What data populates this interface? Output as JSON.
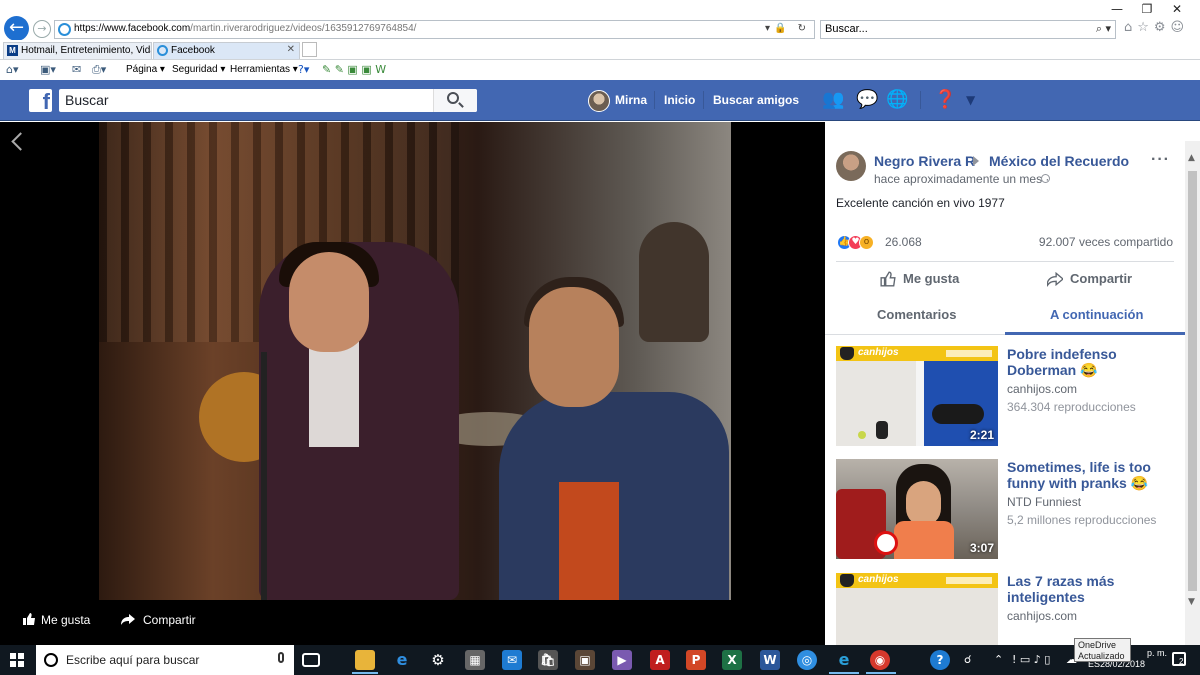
{
  "browser": {
    "url_main": "https://www.facebook.com",
    "url_rest": "/martin.riverarodriguez/videos/1635912769764854/",
    "search_placeholder": "Buscar...",
    "tabs": [
      {
        "label": "Hotmail, Entretenimiento, Vida..."
      },
      {
        "label": "Facebook"
      }
    ],
    "command_bar": {
      "page_label": "Página ▾",
      "security_label": "Seguridad ▾",
      "tools_label": "Herramientas ▾"
    }
  },
  "facebook_bar": {
    "search_placeholder": "Buscar",
    "user_name": "Mirna",
    "home_label": "Inicio",
    "find_friends_label": "Buscar amigos"
  },
  "video_bar": {
    "like_label": "Me gusta",
    "share_label": "Compartir"
  },
  "post": {
    "author": "Negro Rivera R",
    "group": "México del Recuerdo",
    "time": "hace aproximadamente un mes ·",
    "description": "Excelente canción en vivo 1977",
    "reaction_count": "26.068",
    "shares": "92.007 veces compartido",
    "like_label": "Me gusta",
    "share_label": "Compartir",
    "tab_comments": "Comentarios",
    "tab_next": "A continuación"
  },
  "suggestions": [
    {
      "title": "Pobre indefenso Doberman 😂",
      "source": "canhijos.com",
      "views": "364.304 reproducciones",
      "duration": "2:21"
    },
    {
      "title": "Sometimes, life is too funny with pranks 😂",
      "source": "NTD Funniest",
      "views": "5,2 millones reproducciones",
      "duration": "3:07"
    },
    {
      "title": "Las 7 razas más inteligentes",
      "source": "canhijos.com",
      "views": "",
      "duration": ""
    }
  ],
  "taskbar": {
    "search_placeholder": "Escribe aquí para buscar",
    "time": "p. m.",
    "date": "28/02/2018",
    "lang": "ES",
    "notification_count": "2",
    "tooltip_line1": "OneDrive",
    "tooltip_line2": "Actualizado"
  }
}
